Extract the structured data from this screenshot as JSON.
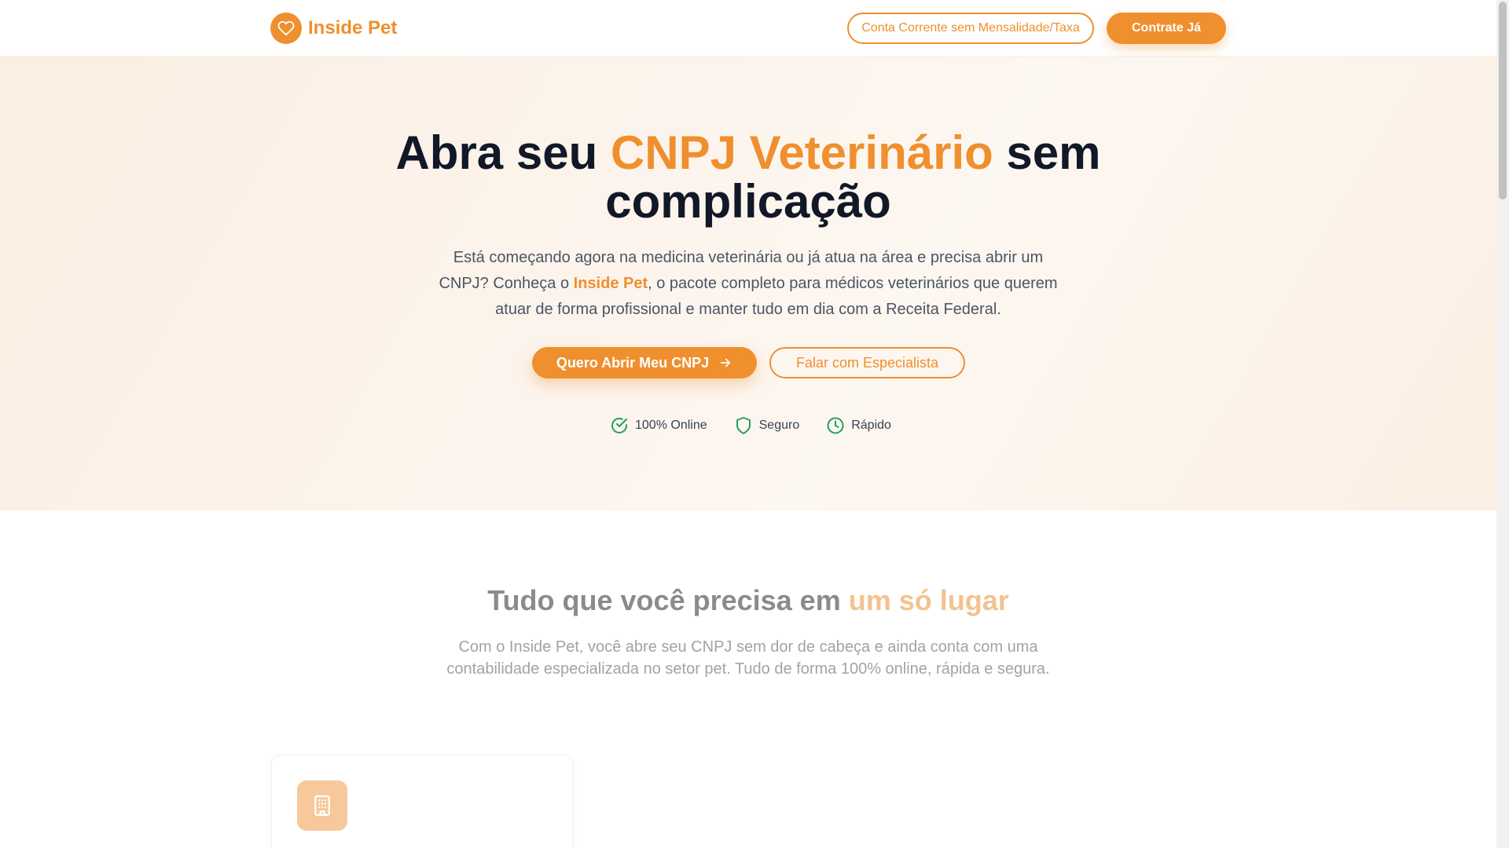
{
  "header": {
    "brand_name": "Inside Pet",
    "logo_icon": "heart-icon",
    "account_button": "Conta Corrente sem Mensalidade/Taxa",
    "cta_button": "Contrate Já"
  },
  "hero": {
    "title_part1": "Abra seu ",
    "title_accent": "CNPJ Veterinário",
    "title_part2": " sem complicação",
    "subtitle_part1": "Está começando agora na medicina veterinária ou já atua na área e precisa abrir um CNPJ? Conheça o ",
    "subtitle_brand": "Inside Pet",
    "subtitle_part2": ", o pacote completo para médicos veterinários que querem atuar de forma profissional e manter tudo em dia com a Receita Federal.",
    "primary_cta": "Quero Abrir Meu CNPJ",
    "secondary_cta": "Falar com Especialista",
    "features": [
      {
        "label": "100% Online",
        "icon": "check-circle-icon"
      },
      {
        "label": "Seguro",
        "icon": "shield-icon"
      },
      {
        "label": "Rápido",
        "icon": "clock-icon"
      }
    ]
  },
  "section2": {
    "title_part1": "Tudo que você precisa em ",
    "title_accent": "um só lugar",
    "subtitle": "Com o Inside Pet, você abre seu CNPJ sem dor de cabeça e ainda conta com uma contabilidade especializada no setor pet. Tudo de forma 100% online, rápida e segura.",
    "card_icon": "building-icon"
  },
  "colors": {
    "brand": "#ef8f2e",
    "feature_icon": "#22a05a",
    "text_dark": "#111827"
  }
}
